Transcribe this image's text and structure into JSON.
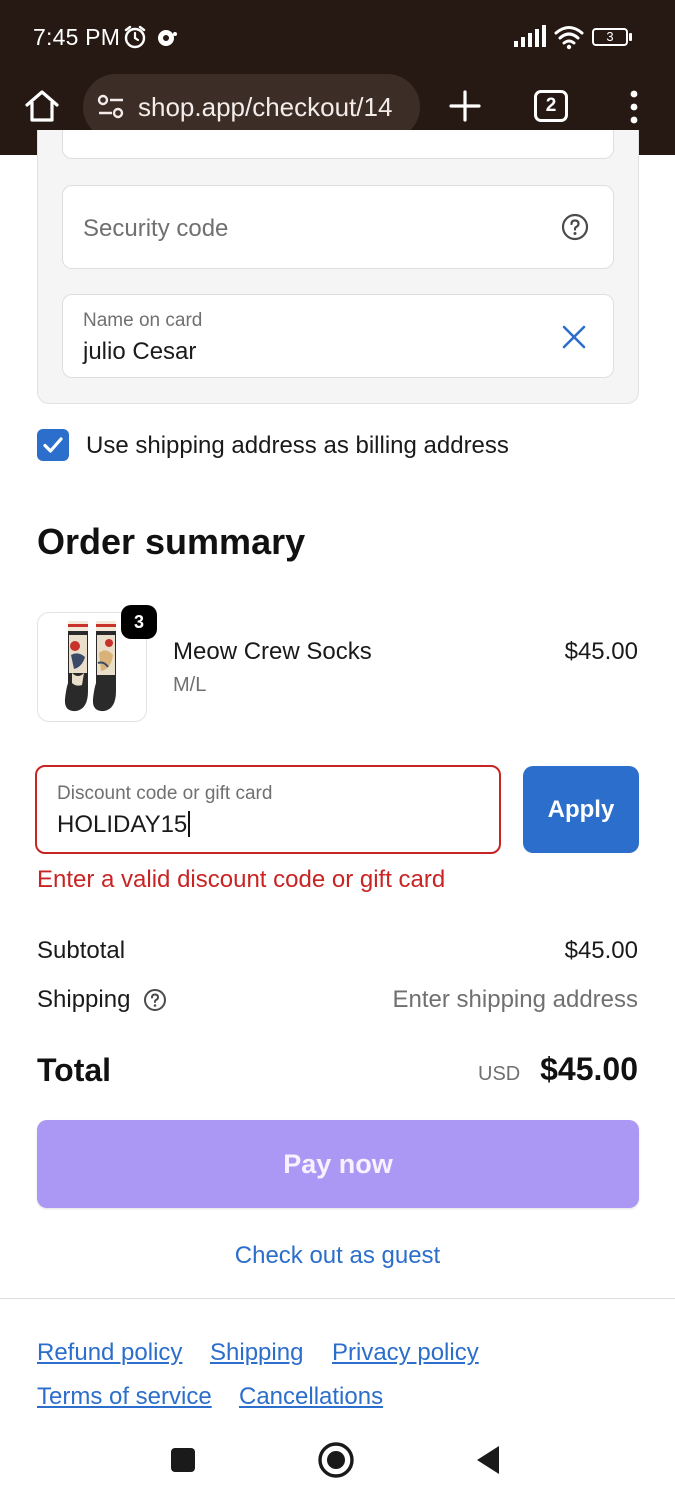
{
  "status_bar": {
    "time": "7:45 PM",
    "battery": "3",
    "icons": [
      "alarm-icon",
      "notification-icon",
      "signal-icon",
      "wifi-icon",
      "battery-icon"
    ]
  },
  "browser": {
    "url": "shop.app/checkout/14",
    "tab_count": "2",
    "icons": [
      "home-icon",
      "site-settings-icon",
      "new-tab-icon",
      "tab-switcher-icon",
      "more-menu-icon"
    ]
  },
  "payment_form": {
    "security_code_placeholder": "Security code",
    "name_on_card_label": "Name on card",
    "name_on_card_value": "julio Cesar",
    "billing_checkbox_label": "Use shipping address as billing address",
    "billing_checkbox_checked": true
  },
  "order_summary": {
    "title": "Order summary",
    "items": [
      {
        "name": "Meow Crew Socks",
        "variant": "M/L",
        "price": "$45.00",
        "quantity": "3"
      }
    ],
    "discount": {
      "label": "Discount code or gift card",
      "value": "HOLIDAY15",
      "apply_label": "Apply",
      "error": "Enter a valid discount code or gift card"
    },
    "subtotal_label": "Subtotal",
    "subtotal_value": "$45.00",
    "shipping_label": "Shipping",
    "shipping_value": "Enter shipping address",
    "total_label": "Total",
    "total_currency": "USD",
    "total_value": "$45.00"
  },
  "actions": {
    "pay_now": "Pay now",
    "guest_checkout": "Check out as guest"
  },
  "footer_links": {
    "refund": "Refund policy",
    "shipping": "Shipping",
    "privacy": "Privacy policy",
    "terms": "Terms of service",
    "cancellations": "Cancellations"
  },
  "colors": {
    "accent": "#2c6ecb",
    "error": "#c82424",
    "pay_button": "#ab98f4",
    "browser_chrome": "#261812"
  }
}
